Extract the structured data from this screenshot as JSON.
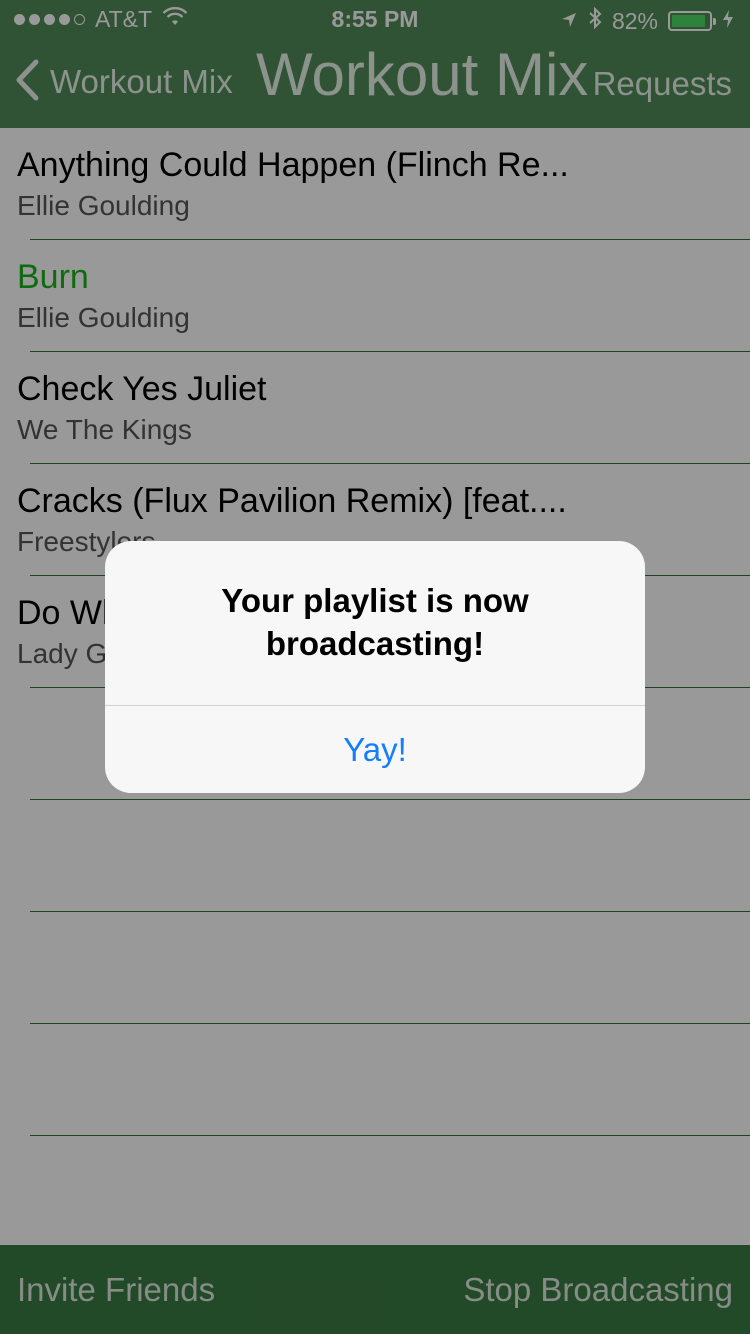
{
  "status_bar": {
    "carrier": "AT&T",
    "time": "8:55 PM",
    "battery": "82%",
    "battery_level": 0.82,
    "signal_bars": 4,
    "icons": [
      "wifi-icon",
      "location-arrow-icon",
      "bluetooth-icon",
      "battery-icon",
      "charging-icon"
    ]
  },
  "nav": {
    "back_label": "Workout Mix",
    "title": "Workout Mix",
    "right_label": "Requests"
  },
  "songs": [
    {
      "title": "Anything Could Happen (Flinch Re...",
      "artist": "Ellie Goulding",
      "playing": false
    },
    {
      "title": "Burn",
      "artist": "Ellie Goulding",
      "playing": true
    },
    {
      "title": "Check Yes Juliet",
      "artist": "We The Kings",
      "playing": false
    },
    {
      "title": "Cracks (Flux Pavilion Remix) [feat....",
      "artist": "Freestylers",
      "playing": false
    },
    {
      "title": "Do What U Want (feat. R. Kelly)",
      "artist": "Lady Gaga",
      "playing": false
    }
  ],
  "toolbar": {
    "left_label": "Invite Friends",
    "right_label": "Stop Broadcasting"
  },
  "alert": {
    "message": "Your playlist is now broadcasting!",
    "button_label": "Yay!"
  },
  "colors": {
    "nav_green": "#4f8b57",
    "playing_green": "#1ab31a",
    "alert_button_blue": "#157efb"
  }
}
